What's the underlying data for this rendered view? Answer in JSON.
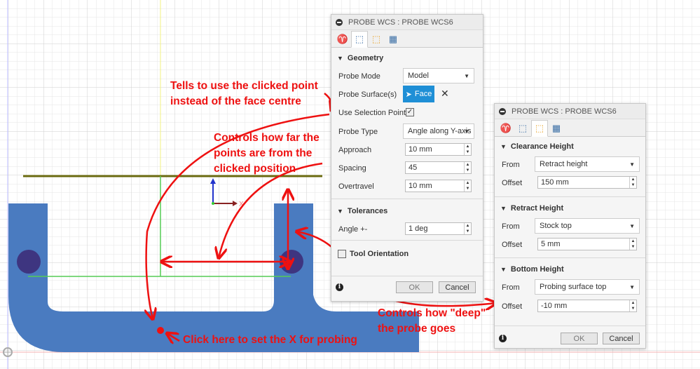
{
  "viewport": {
    "axis_label_x": "X",
    "colors": {
      "part": "#4a7bc0",
      "hole": "#3e3580",
      "annotation": "#ee1111",
      "accent": "#1f8fd6"
    }
  },
  "panel1": {
    "title": "PROBE WCS : PROBE WCS6",
    "tabs": [
      "tool-icon",
      "geometry-icon",
      "heights-icon",
      "passes-icon"
    ],
    "geometry": {
      "header": "Geometry",
      "probe_mode_label": "Probe Mode",
      "probe_mode_value": "Model",
      "probe_surface_label": "Probe Surface(s)",
      "face_label": "Face",
      "use_selection_point_label": "Use Selection Point",
      "use_selection_point_checked": true,
      "probe_type_label": "Probe Type",
      "probe_type_value": "Angle along Y-axis",
      "approach_label": "Approach",
      "approach_value": "10 mm",
      "spacing_label": "Spacing",
      "spacing_value": "45",
      "overtravel_label": "Overtravel",
      "overtravel_value": "10 mm"
    },
    "tolerances": {
      "header": "Tolerances",
      "angle_label": "Angle +-",
      "angle_value": "1 deg"
    },
    "tool_orientation": {
      "label": "Tool Orientation",
      "checked": false
    },
    "ok": "OK",
    "cancel": "Cancel"
  },
  "panel2": {
    "title": "PROBE WCS : PROBE WCS6",
    "clearance": {
      "header": "Clearance Height",
      "from_label": "From",
      "from_value": "Retract height",
      "offset_label": "Offset",
      "offset_value": "150 mm"
    },
    "retract": {
      "header": "Retract Height",
      "from_label": "From",
      "from_value": "Stock top",
      "offset_label": "Offset",
      "offset_value": "5 mm"
    },
    "bottom": {
      "header": "Bottom Height",
      "from_label": "From",
      "from_value": "Probing surface top",
      "offset_label": "Offset",
      "offset_value": "-10 mm"
    },
    "ok": "OK",
    "cancel": "Cancel"
  },
  "annotations": {
    "selection_point": [
      "Tells to use the clicked point",
      "instead of the face centre"
    ],
    "spacing": [
      "Controls how far the",
      "points are from the",
      "clicked position"
    ],
    "click": "Click here to set the X for probing",
    "depth": [
      "Controls how \"deep\"",
      "the probe goes"
    ]
  }
}
